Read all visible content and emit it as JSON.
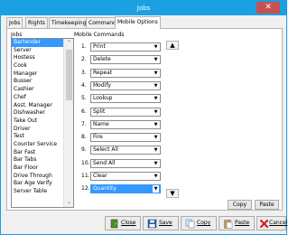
{
  "window": {
    "title": "Jobs",
    "close_glyph": "✕"
  },
  "tabs": [
    {
      "label": "Jobs"
    },
    {
      "label": "Rights"
    },
    {
      "label": "Timekeeping"
    },
    {
      "label": "Commands"
    },
    {
      "label": "Mobile Options",
      "active": true
    }
  ],
  "jobs": {
    "label": "Jobs",
    "items": [
      "Bartender",
      "Server",
      "Hostess",
      "Cook",
      "Manager",
      "Busser",
      "Cashier",
      "Chef",
      "Asst. Manager",
      "Dishwasher",
      "Take Out",
      "Driver",
      "Test",
      "Counter Service",
      "Bar Fast",
      "Bar Tabs",
      "Bar Floor",
      "Drive Through",
      "Bar Age Verify",
      "Server Table"
    ],
    "selected": "Bartender"
  },
  "mobile_commands": {
    "label": "Mobile Commands",
    "rows": [
      {
        "num": "1.",
        "value": "Print"
      },
      {
        "num": "2.",
        "value": "Delete"
      },
      {
        "num": "3.",
        "value": "Repeat"
      },
      {
        "num": "4.",
        "value": "Modify"
      },
      {
        "num": "5.",
        "value": "Lookup"
      },
      {
        "num": "6.",
        "value": "Split"
      },
      {
        "num": "7.",
        "value": "Name"
      },
      {
        "num": "8.",
        "value": "Fire"
      },
      {
        "num": "9.",
        "value": "Select All"
      },
      {
        "num": "10.",
        "value": "Send All"
      },
      {
        "num": "11.",
        "value": "Clear"
      },
      {
        "num": "12.",
        "value": "Quantity"
      }
    ],
    "highlighted_row": "12."
  },
  "panel_buttons": {
    "copy": "Copy",
    "paste": "Paste"
  },
  "footer": {
    "close": "Close",
    "save": "Save",
    "copy": "Copy",
    "paste": "Paste",
    "cancel": "Cancel"
  },
  "colors": {
    "titlebar": "#1ba1e2",
    "close_button": "#c75050",
    "selection": "#3399ff"
  }
}
